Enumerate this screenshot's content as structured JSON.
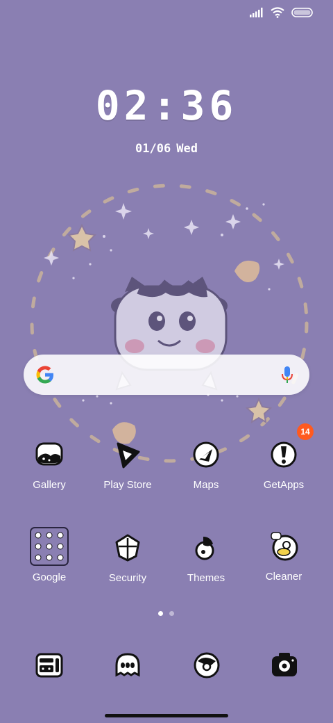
{
  "colors": {
    "background": "#8a7fb2",
    "badge": "#ff5a1f"
  },
  "status_bar": {
    "icons": [
      "signal-icon",
      "wifi-icon",
      "battery-icon"
    ]
  },
  "clock": {
    "time": "02:36"
  },
  "date": {
    "day_month": "01/06",
    "weekday": "Wed"
  },
  "search": {
    "logo": "google-logo",
    "mic_icon": "microphone-icon"
  },
  "apps": [
    {
      "label": "Gallery",
      "icon": "gallery-icon"
    },
    {
      "label": "Play Store",
      "icon": "play-store-icon"
    },
    {
      "label": "Maps",
      "icon": "maps-icon"
    },
    {
      "label": "GetApps",
      "icon": "getapps-icon",
      "badge": "14"
    },
    {
      "label": "Google",
      "icon": "google-folder-icon"
    },
    {
      "label": "Security",
      "icon": "security-icon"
    },
    {
      "label": "Themes",
      "icon": "themes-icon"
    },
    {
      "label": "Cleaner",
      "icon": "cleaner-icon"
    }
  ],
  "page_indicator": {
    "pages": 2,
    "current": 1
  },
  "dock": [
    {
      "icon": "phone-icon"
    },
    {
      "icon": "messages-icon"
    },
    {
      "icon": "browser-icon"
    },
    {
      "icon": "camera-icon"
    }
  ]
}
